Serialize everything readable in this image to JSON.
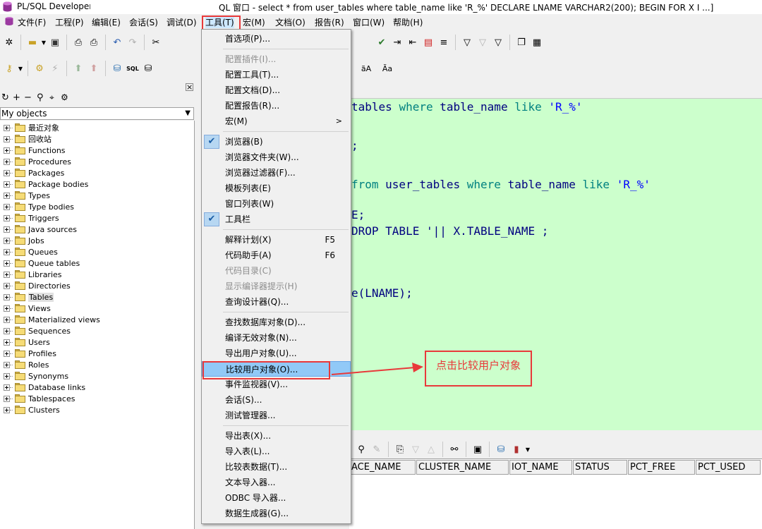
{
  "title": {
    "app_name": "PL/SQL Developer",
    "window_title": "QL 窗口 - select * from user_tables where table_name like 'R_%' DECLARE LNAME VARCHAR2(200); BEGIN FOR X I ...]"
  },
  "menubar": [
    "文件(F)",
    "工程(P)",
    "编辑(E)",
    "会话(S)",
    "调试(D)",
    "工具(T)",
    "宏(M)",
    "文档(O)",
    "报告(R)",
    "窗口(W)",
    "帮助(H)"
  ],
  "tools_menu": {
    "items": [
      {
        "label": "首选项(P)...",
        "shortcut": "",
        "disabled": false,
        "checked": false
      },
      {
        "label": "配置插件(I)...",
        "shortcut": "",
        "disabled": true,
        "checked": false
      },
      {
        "label": "配置工具(T)...",
        "shortcut": "",
        "disabled": false,
        "checked": false
      },
      {
        "label": "配置文档(D)...",
        "shortcut": "",
        "disabled": false,
        "checked": false
      },
      {
        "label": "配置报告(R)...",
        "shortcut": "",
        "disabled": false,
        "checked": false
      },
      {
        "label": "宏(M)",
        "shortcut": "",
        "disabled": false,
        "checked": false
      },
      {
        "label": "浏览器(B)",
        "shortcut": "",
        "disabled": false,
        "checked": true
      },
      {
        "label": "浏览器文件夹(W)...",
        "shortcut": "",
        "disabled": false,
        "checked": false
      },
      {
        "label": "浏览器过滤器(F)...",
        "shortcut": "",
        "disabled": false,
        "checked": false
      },
      {
        "label": "模板列表(E)",
        "shortcut": "",
        "disabled": false,
        "checked": false
      },
      {
        "label": "窗口列表(W)",
        "shortcut": "",
        "disabled": false,
        "checked": false
      },
      {
        "label": "工具栏",
        "shortcut": "",
        "disabled": false,
        "checked": true
      },
      {
        "label": "解释计划(X)",
        "shortcut": "F5",
        "disabled": false,
        "checked": false
      },
      {
        "label": "代码助手(A)",
        "shortcut": "F6",
        "disabled": false,
        "checked": false
      },
      {
        "label": "代码目录(C)",
        "shortcut": "",
        "disabled": true,
        "checked": false
      },
      {
        "label": "显示编译器提示(H)",
        "shortcut": "",
        "disabled": true,
        "checked": false
      },
      {
        "label": "查询设计器(Q)...",
        "shortcut": "",
        "disabled": false,
        "checked": false
      },
      {
        "label": "查找数据库对象(D)...",
        "shortcut": "",
        "disabled": false,
        "checked": false
      },
      {
        "label": "编译无效对象(N)...",
        "shortcut": "",
        "disabled": false,
        "checked": false
      },
      {
        "label": "导出用户对象(U)...",
        "shortcut": "",
        "disabled": false,
        "checked": false
      },
      {
        "label": "比较用户对象(O)...",
        "shortcut": "",
        "disabled": false,
        "checked": false
      },
      {
        "label": "事件监视器(V)...",
        "shortcut": "",
        "disabled": false,
        "checked": false
      },
      {
        "label": "会话(S)...",
        "shortcut": "",
        "disabled": false,
        "checked": false
      },
      {
        "label": "测试管理器...",
        "shortcut": "",
        "disabled": false,
        "checked": false
      },
      {
        "label": "导出表(X)...",
        "shortcut": "",
        "disabled": false,
        "checked": false
      },
      {
        "label": "导入表(L)...",
        "shortcut": "",
        "disabled": false,
        "checked": false
      },
      {
        "label": "比较表数据(T)...",
        "shortcut": "",
        "disabled": false,
        "checked": false
      },
      {
        "label": "文本导入器...",
        "shortcut": "",
        "disabled": false,
        "checked": false
      },
      {
        "label": "ODBC 导入器...",
        "shortcut": "",
        "disabled": false,
        "checked": false
      },
      {
        "label": "数据生成器(G)...",
        "shortcut": "",
        "disabled": false,
        "checked": false
      }
    ],
    "macro_submenu_arrow": ">",
    "check_glyph": "✔"
  },
  "left_panel": {
    "selector_value": "My objects",
    "tree": [
      "最近对象",
      "回收站",
      "Functions",
      "Procedures",
      "Packages",
      "Package bodies",
      "Types",
      "Type bodies",
      "Triggers",
      "Java sources",
      "Jobs",
      "Queues",
      "Queue tables",
      "Libraries",
      "Directories",
      "Tables",
      "Views",
      "Materialized views",
      "Sequences",
      "Users",
      "Profiles",
      "Roles",
      "Synonyms",
      "Database links",
      "Tablespaces",
      "Clusters"
    ],
    "selected": "Tables"
  },
  "editor": {
    "lines": [
      [
        {
          "t": "tables ",
          "c": "plain"
        },
        {
          "t": "where",
          "c": "kw"
        },
        {
          "t": " table_name ",
          "c": "plain"
        },
        {
          "t": "like",
          "c": "kw"
        },
        {
          "t": " 'R_%'",
          "c": "str"
        }
      ],
      [
        {
          "t": ";",
          "c": "plain"
        }
      ],
      [
        {
          "t": "from",
          "c": "kw"
        },
        {
          "t": " user_tables ",
          "c": "plain"
        },
        {
          "t": "where",
          "c": "kw"
        },
        {
          "t": " table_name ",
          "c": "plain"
        },
        {
          "t": "like",
          "c": "kw"
        },
        {
          "t": " 'R_%'",
          "c": "str"
        }
      ],
      [
        {
          "t": "E;",
          "c": "plain"
        }
      ],
      [
        {
          "t": "DROP TABLE '|| X.TABLE_NAME ;",
          "c": "plain"
        }
      ],
      [
        {
          "t": "e(LNAME);",
          "c": "plain"
        }
      ]
    ]
  },
  "result_columns": [
    "ACE_NAME",
    "CLUSTER_NAME",
    "IOT_NAME",
    "STATUS",
    "PCT_FREE",
    "PCT_USED"
  ],
  "annotation": {
    "callout_text": "点击比较用户对象",
    "color": "#e8393a"
  },
  "colors": {
    "editor_bg": "#ccffcc",
    "highlight": "#91c9f7",
    "keyword": "#008080",
    "string": "#0000ff"
  }
}
